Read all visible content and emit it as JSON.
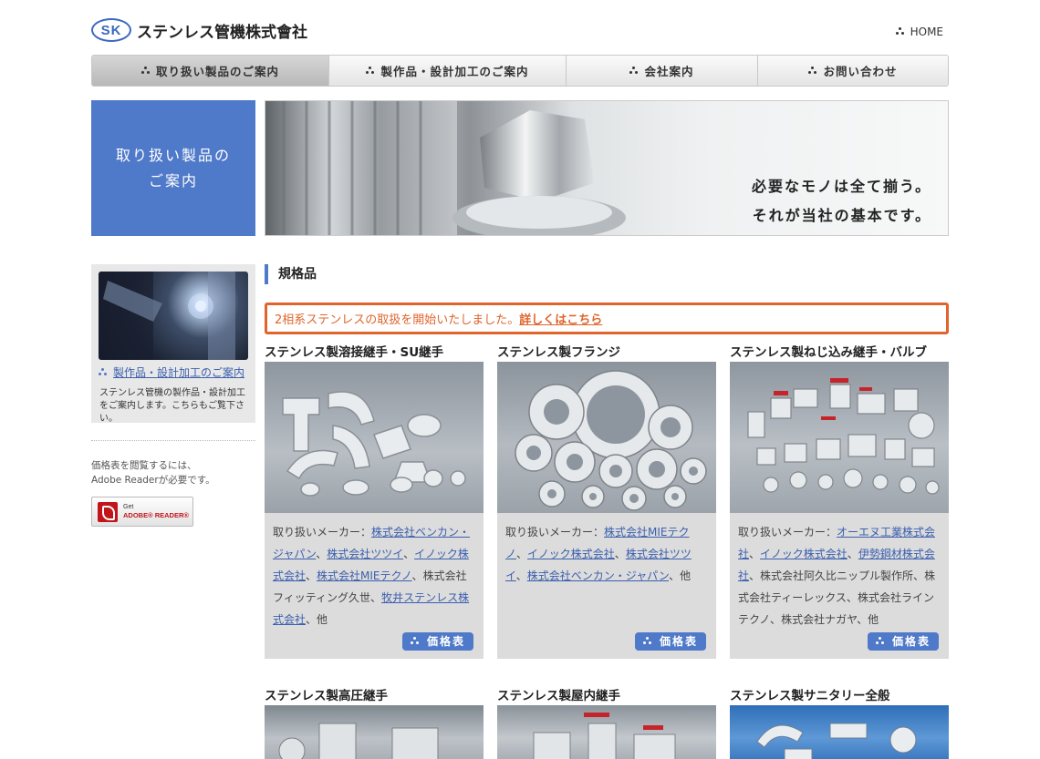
{
  "header": {
    "logo_mark": "SK",
    "company_name": "ステンレス管機株式會社",
    "home_label": "HOME"
  },
  "nav": {
    "items": [
      {
        "label": "取り扱い製品のご案内",
        "active": true
      },
      {
        "label": "製作品・設計加工のご案内",
        "active": false
      },
      {
        "label": "会社案内",
        "active": false
      },
      {
        "label": "お問い合わせ",
        "active": false
      }
    ]
  },
  "hero": {
    "left_line1": "取り扱い製品の",
    "left_line2": "ご案内",
    "copy_line1": "必要なモノは全て揃う。",
    "copy_line2": "それが当社の基本です。"
  },
  "sidebar": {
    "link_label": "製作品・設計加工のご案内",
    "description": "ステンレス管機の製作品・設計加工をご案内します。こちらもご覧下さい。",
    "reader_note_line1": "価格表を閲覧するには、",
    "reader_note_line2": "Adobe Readerが必要です。",
    "reader_badge_get": "Get",
    "reader_badge_name": "ADOBE® READER®"
  },
  "main": {
    "section_title": "規格品",
    "notice_text": "2相系ステンレスの取扱を開始いたしました。",
    "notice_link": "詳しくはこちら",
    "price_label": "価格表",
    "cards": [
      {
        "title": "ステンレス製溶接継手・SU継手",
        "maker_prefix": "取り扱いメーカー：",
        "makers": [
          {
            "name": "株式会社ベンカン・ジャパン",
            "link": true
          },
          {
            "name": "株式会社ツツイ",
            "link": true
          },
          {
            "name": "イノック株式会社",
            "link": true
          },
          {
            "name": "株式会社MIEテクノ",
            "link": true
          },
          {
            "name": "株式会社フィッティング久世",
            "link": false
          },
          {
            "name": "牧井ステンレス株式会社",
            "link": true
          }
        ],
        "suffix": "、他"
      },
      {
        "title": "ステンレス製フランジ",
        "maker_prefix": "取り扱いメーカー：",
        "makers": [
          {
            "name": "株式会社MIEテクノ",
            "link": true
          },
          {
            "name": "イノック株式会社",
            "link": true
          },
          {
            "name": "株式会社ツツイ",
            "link": true
          },
          {
            "name": "株式会社ベンカン・ジャパン",
            "link": true
          }
        ],
        "suffix": "、他"
      },
      {
        "title": "ステンレス製ねじ込み継手・バルブ",
        "maker_prefix": "取り扱いメーカー：",
        "makers": [
          {
            "name": "オーエヌ工業株式会社",
            "link": true
          },
          {
            "name": "イノック株式会社",
            "link": true
          },
          {
            "name": "伊勢鋼材株式会社",
            "link": true
          },
          {
            "name": "株式会社阿久比ニップル製作所",
            "link": false
          },
          {
            "name": "株式会社ティーレックス",
            "link": false
          },
          {
            "name": "株式会社ラインテクノ",
            "link": false
          },
          {
            "name": "株式会社ナガヤ",
            "link": false
          }
        ],
        "suffix": "、他"
      }
    ],
    "next_row_titles": [
      "ステンレス製高圧継手",
      "ステンレス製屋内継手",
      "ステンレス製サニタリー全般"
    ]
  },
  "colors": {
    "accent_blue": "#4f79c9",
    "notice_orange": "#e0642c",
    "link_blue": "#3b5fae"
  }
}
